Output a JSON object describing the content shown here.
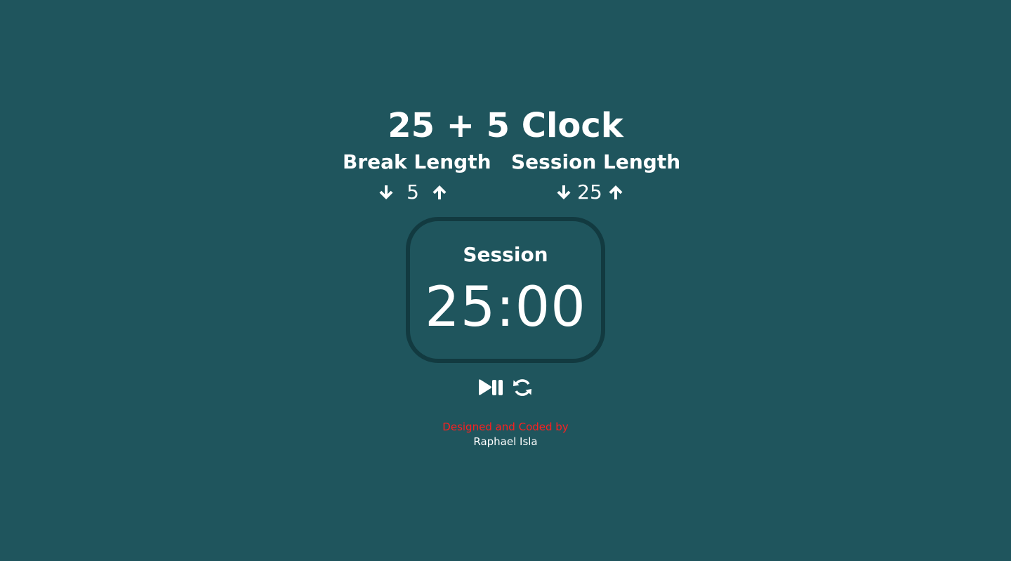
{
  "app": {
    "title": "25 + 5 Clock"
  },
  "break": {
    "label": "Break Length",
    "value": "5",
    "decrement_icon": "arrow-down-icon",
    "increment_icon": "arrow-up-icon"
  },
  "session": {
    "label": "Session Length",
    "value": "25",
    "decrement_icon": "arrow-down-icon",
    "increment_icon": "arrow-up-icon"
  },
  "timer": {
    "label": "Session",
    "time": "25:00"
  },
  "controls": {
    "play_pause_icon": "play-pause-icon",
    "reset_icon": "refresh-icon"
  },
  "footer": {
    "credit": "Designed and Coded by",
    "author": "Raphael Isla"
  },
  "colors": {
    "background": "#1f555d",
    "timer_border": "#123a40",
    "text": "#ffffff",
    "credit": "#ff1f1f"
  }
}
